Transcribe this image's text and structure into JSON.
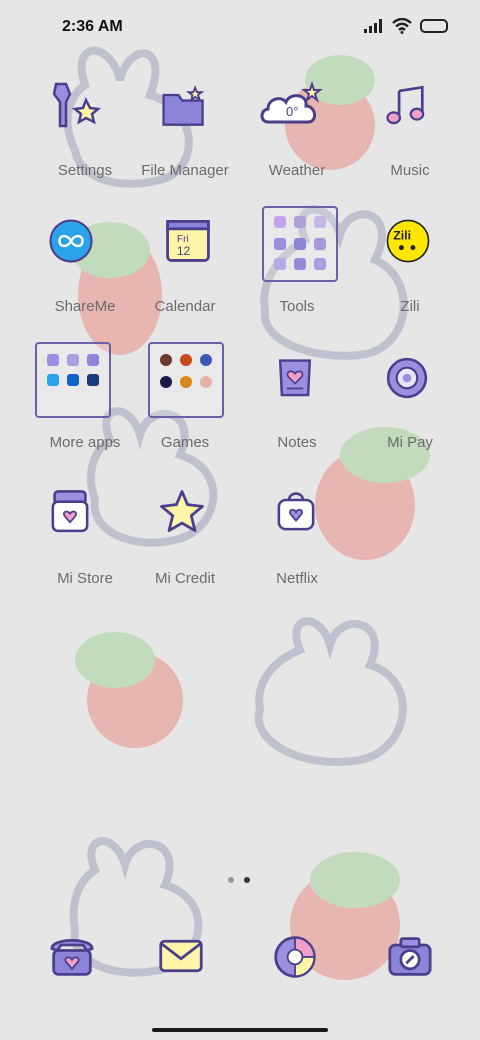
{
  "status": {
    "time": "2:36 AM"
  },
  "apps": {
    "settings": "Settings",
    "file_manager": "File Manager",
    "weather": "Weather",
    "weather_temp": "0°",
    "music": "Music",
    "shareme": "ShareMe",
    "calendar": "Calendar",
    "calendar_day": "Fri",
    "calendar_date": "12",
    "tools": "Tools",
    "zili": "Zili",
    "zili_logo": "Zili",
    "more_apps": "More apps",
    "games": "Games",
    "notes": "Notes",
    "mi_pay": "Mi Pay",
    "mi_store": "Mi Store",
    "mi_credit": "Mi Credit",
    "netflix": "Netflix"
  },
  "pager": {
    "pages": 2,
    "current": 2
  },
  "colors": {
    "accent": "#6b5fa8",
    "lavender": "#9b8fe0",
    "pink": "#f0a0c8",
    "yellow": "#fff5a8"
  }
}
